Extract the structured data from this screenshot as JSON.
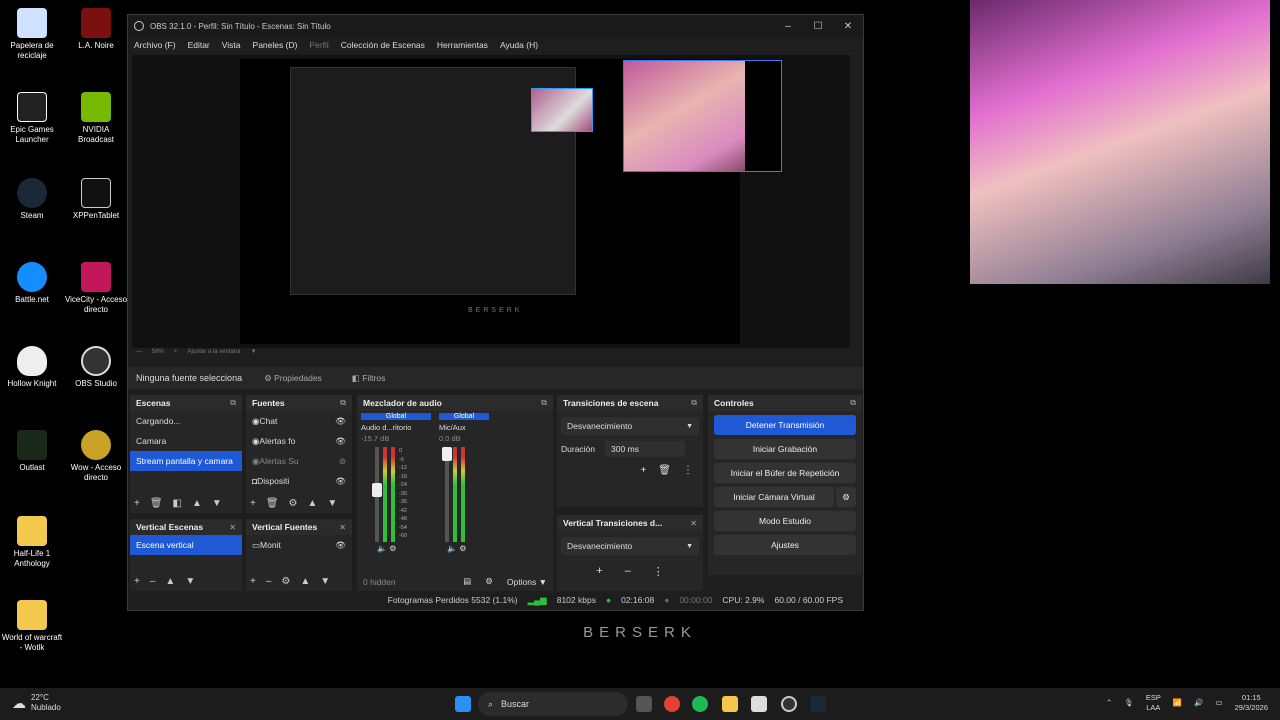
{
  "desktop": {
    "icons": [
      {
        "label": "Papelera de reciclaje",
        "x": 0
      },
      {
        "label": "L.A. Noire"
      },
      {
        "label": "Epic Games Launcher"
      },
      {
        "label": "NVIDIA Broadcast"
      },
      {
        "label": "Steam"
      },
      {
        "label": "XPPenTablet"
      },
      {
        "label": "Battle.net"
      },
      {
        "label": "ViceCity - Acceso directo"
      },
      {
        "label": "Hollow Knight"
      },
      {
        "label": "OBS Studio"
      },
      {
        "label": "Outlast"
      },
      {
        "label": "Wow - Acceso directo"
      },
      {
        "label": "Half-Life 1 Anthology"
      },
      {
        "label": "World of warcraft - Wotlk"
      }
    ],
    "watermark": "BERSERK",
    "nested_watermark": "BERSERK"
  },
  "obs": {
    "title": "OBS 32.1.0 - Perfil: Sin Título - Escenas: Sin Título",
    "menu": [
      "Archivo (F)",
      "Editar",
      "Vista",
      "Paneles (D)",
      "Perfil",
      "Colección de Escenas",
      "Herramientas",
      "Ayuda (H)"
    ],
    "zoom": {
      "percent": "58%",
      "fit": "Ajustar a la ventana"
    },
    "source_bar": {
      "none_selected": "Ninguna fuente selecciona",
      "properties": "Propiedades",
      "filters": "Filtros"
    },
    "scenes": {
      "title": "Escenas",
      "items": [
        "Cargando...",
        "Camara",
        "Stream pantalla y camara"
      ],
      "selected_index": 2
    },
    "sources": {
      "title": "Fuentes",
      "items": [
        "Chat",
        "Alertas fo",
        "Alertas Su",
        "Dispositi"
      ]
    },
    "vertical_scenes": {
      "title": "Vertical Escenas",
      "items": [
        "Escena vertical"
      ]
    },
    "vertical_sources": {
      "title": "Vertical Fuentes",
      "items": [
        "Monit"
      ]
    },
    "mixer": {
      "title": "Mezclador de audio",
      "channels": [
        {
          "tag": "Global",
          "name": "Audio d...ritorio",
          "db": "-15.7 dB"
        },
        {
          "tag": "Global",
          "name": "Mic/Aux",
          "db": "0.0 dB"
        }
      ],
      "scale": [
        "0",
        "-6",
        "-12",
        "-18",
        "-24",
        "-30",
        "-36",
        "-42",
        "-48",
        "-54",
        "-60"
      ],
      "hidden": "0 hidden",
      "options": "Options"
    },
    "transitions": {
      "title": "Transiciones de escena",
      "selected": "Desvanecimiento",
      "duration_label": "Duración",
      "duration_value": "300 ms"
    },
    "vertical_transitions": {
      "title": "Vertical Transiciones d...",
      "selected": "Desvanecimiento"
    },
    "controls": {
      "title": "Controles",
      "buttons": [
        "Detener Transmisión",
        "Iniciar Grabación",
        "Iniciar el Búfer de Repetición",
        "Iniciar Cámara Virtual",
        "Modo Estudio",
        "Ajustes"
      ]
    },
    "status": {
      "dropped": "Fotogramas Perdidos 5532 (1.1%)",
      "bitrate": "8102 kbps",
      "stream_time": "02:16:08",
      "rec_time": "00:00:00",
      "cpu": "CPU: 2.9%",
      "fps": "60.00 / 60.00 FPS"
    }
  },
  "taskbar": {
    "weather_temp": "22°C",
    "weather_desc": "Nublado",
    "search": "Buscar",
    "lang1": "ESP",
    "lang2": "LAA",
    "time": "01:15",
    "date": "29/3/2026"
  },
  "colors": {
    "accent": "#1f59d6",
    "bg": "#1e1e1e",
    "meter_green": "#2fbf3a"
  }
}
